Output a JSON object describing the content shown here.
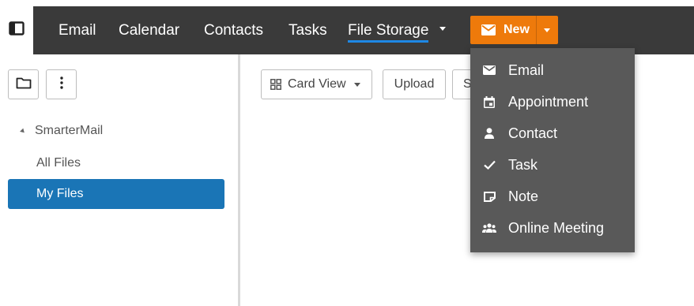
{
  "topbar": {
    "sidebar_toggle_icon": "sidebar-panel-icon",
    "nav": [
      {
        "label": "Email"
      },
      {
        "label": "Calendar"
      },
      {
        "label": "Contacts"
      },
      {
        "label": "Tasks"
      },
      {
        "label": "File Storage",
        "active": true
      }
    ],
    "new_button": {
      "label": "New",
      "icon": "envelope-icon",
      "color": "#ee7a0b"
    },
    "bar_color": "#3a3a3a",
    "active_underline_color": "#1e88e5"
  },
  "sidebar": {
    "folder_button_icon": "folder-icon",
    "more_button_icon": "more-vertical-icon",
    "tree": {
      "root": "SmarterMail",
      "items": [
        {
          "label": "All Files"
        },
        {
          "label": "My Files",
          "selected": true
        }
      ]
    },
    "selected_color": "#1a75b6"
  },
  "toolbar": {
    "view_label": "Card View",
    "view_icon": "grid-icon",
    "upload_label": "Upload",
    "partial_label": "S"
  },
  "new_menu": {
    "background": "#595959",
    "items": [
      {
        "label": "Email",
        "icon": "envelope-icon"
      },
      {
        "label": "Appointment",
        "icon": "calendar-icon"
      },
      {
        "label": "Contact",
        "icon": "person-icon"
      },
      {
        "label": "Task",
        "icon": "checkmark-icon"
      },
      {
        "label": "Note",
        "icon": "note-icon"
      },
      {
        "label": "Online Meeting",
        "icon": "group-icon"
      }
    ]
  }
}
